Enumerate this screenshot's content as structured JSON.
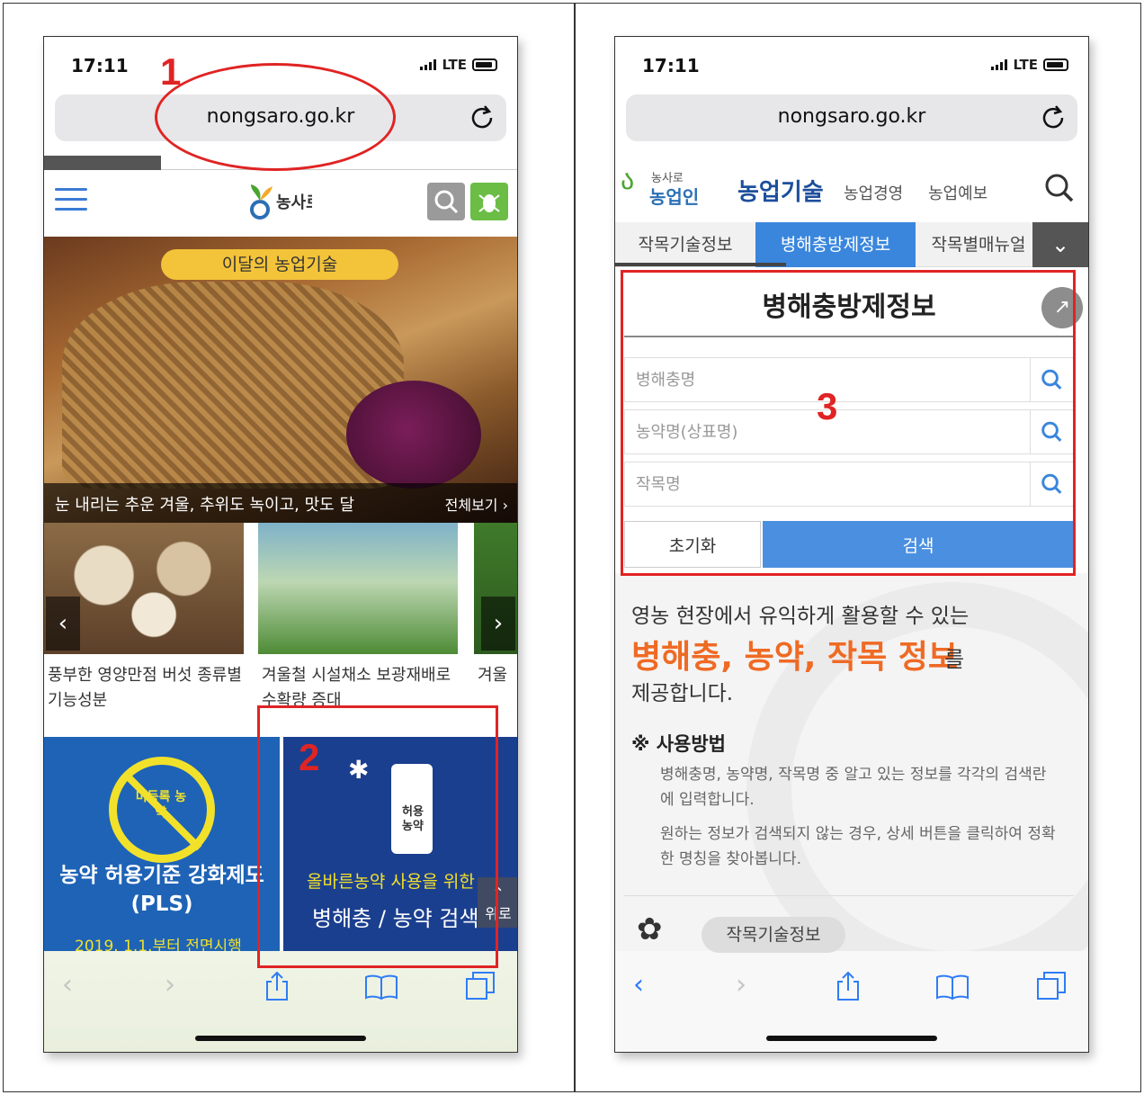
{
  "status": {
    "time": "17:11",
    "network": "LTE"
  },
  "browser": {
    "url": "nongsaro.go.kr"
  },
  "left": {
    "hero": {
      "badge": "이달의 농업기술",
      "caption": "눈 내리는 추운 겨울, 추위도 녹이고, 맛도 달",
      "view_all": "전체보기 ›"
    },
    "cards": [
      {
        "caption": "풍부한 영양만점 버섯 종류별 기능성분"
      },
      {
        "caption": "겨울철 시설채소 보광재배로 수확량 증대"
      },
      {
        "caption": "겨울"
      }
    ],
    "banner1": {
      "sign_text": "미등록 농약",
      "title": "농약 허용기준 강화제도(PLS)",
      "note": "2019. 1.1.부터 전면시행"
    },
    "banner2": {
      "bottle_label": "허용 농약",
      "line1": "올바른농약 사용을 위한",
      "line2": "병해충 / 농약 검색",
      "top_btn": "위로"
    }
  },
  "right": {
    "logo_small": "농사로",
    "logo_main": "농업인",
    "nav_title": "농업기술",
    "nav_sub1": "농업경영",
    "nav_sub2": "농업예보",
    "tabs": [
      "작목기술정보",
      "병해충방제정보",
      "작목별매뉴얼"
    ],
    "panel_title": "병해충방제정보",
    "fields": [
      {
        "placeholder": "병해충명"
      },
      {
        "placeholder": "농약명(상표명)"
      },
      {
        "placeholder": "작목명"
      }
    ],
    "reset_label": "초기화",
    "search_label": "검색",
    "intro": {
      "line1": "영농 현장에서 유익하게 활용할 수 있는",
      "line2": "병해충, 농약, 작목 정보",
      "line2_suffix": "를",
      "line3": "제공합니다.",
      "howto_title": "※ 사용방법",
      "howto_p1": "병해충명, 농약명, 작목명 중 알고 있는 정보를 각각의 검색란에 입력합니다.",
      "howto_p2": "원하는 정보가 검색되지 않는 경우, 상세 버튼을 클릭하여 정확한 명칭을 찾아봅니다."
    },
    "section_label": "작목기술정보"
  },
  "annotations": [
    "1",
    "2",
    "3"
  ],
  "colors": {
    "annotation": "#e02424",
    "accent": "#3a86dd",
    "highlight": "#ef6a24"
  }
}
